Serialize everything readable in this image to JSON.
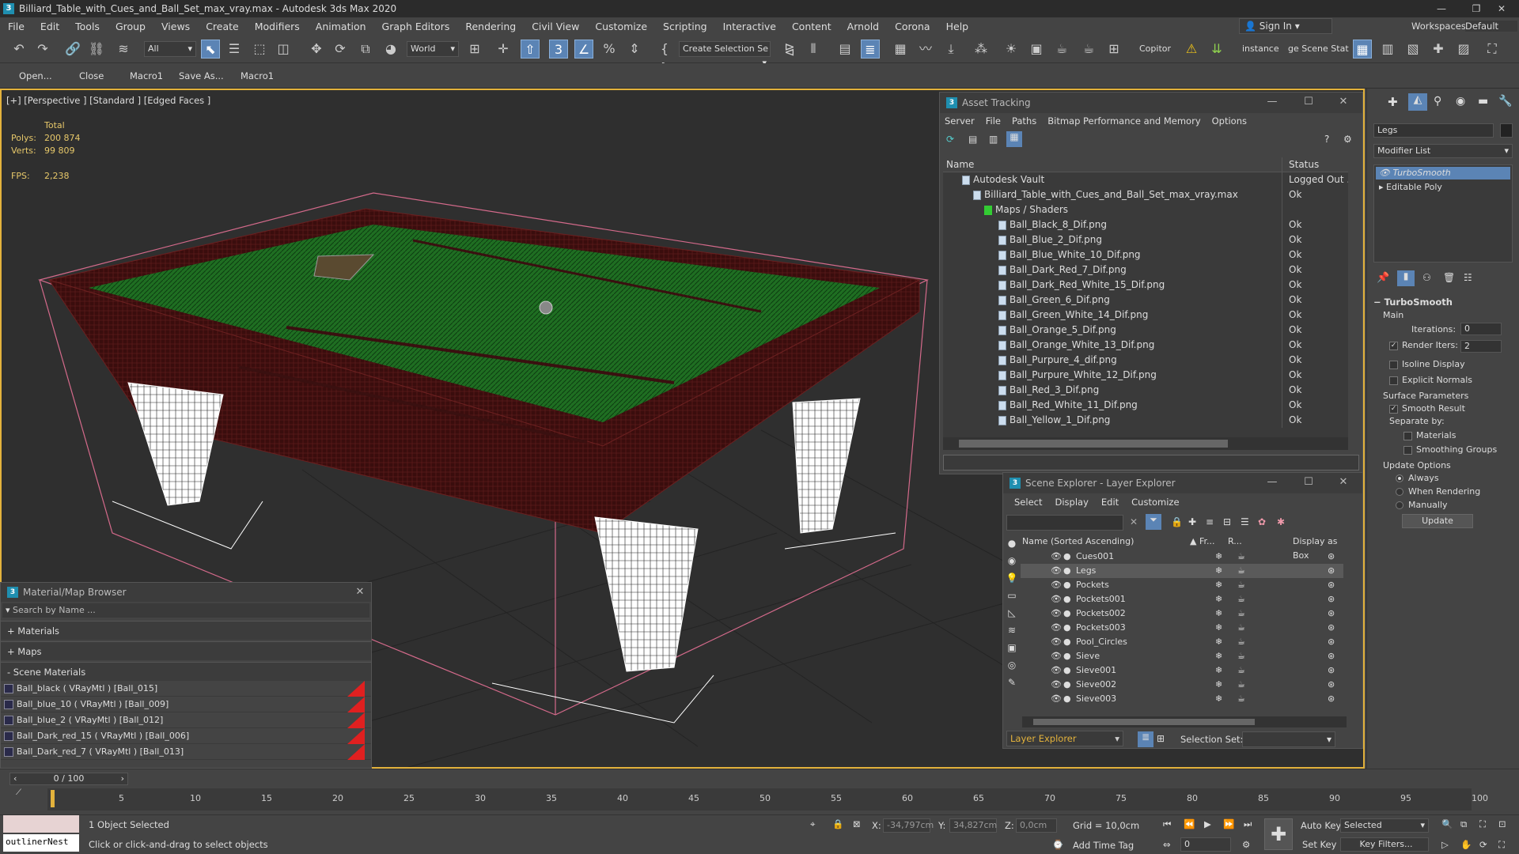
{
  "window": {
    "title": "Billiard_Table_with_Cues_and_Ball_Set_max_vray.max - Autodesk 3ds Max 2020",
    "sign_in": "Sign In",
    "workspaces_label": "Workspaces:",
    "workspaces_value": "Default"
  },
  "menu": [
    "File",
    "Edit",
    "Tools",
    "Group",
    "Views",
    "Create",
    "Modifiers",
    "Animation",
    "Graph Editors",
    "Rendering",
    "Civil View",
    "Customize",
    "Scripting",
    "Interactive",
    "Content",
    "Arnold",
    "Corona",
    "Help"
  ],
  "toolbar": {
    "filter": "All",
    "coord": "World",
    "selection_set": "Create Selection Se",
    "copitor": "Copitor",
    "instance": "instance",
    "scene_stat": "ge Scene Stat"
  },
  "macros": [
    "Open...",
    "Close",
    "Macro1",
    "Save As...",
    "Macro1"
  ],
  "viewport": {
    "label": "[+] [Perspective ] [Standard ] [Edged Faces ]",
    "total_label": "Total",
    "polys_label": "Polys:",
    "polys": "200 874",
    "verts_label": "Verts:",
    "verts": "99 809",
    "fps_label": "FPS:",
    "fps": "2,238"
  },
  "asset_tracking": {
    "title": "Asset Tracking",
    "menu": [
      "Server",
      "File",
      "Paths",
      "Bitmap Performance and Memory",
      "Options"
    ],
    "col_name": "Name",
    "col_status": "Status",
    "rows": [
      {
        "name": "Autodesk Vault",
        "status": "Logged Out ..."
      },
      {
        "name": "Billiard_Table_with_Cues_and_Ball_Set_max_vray.max",
        "status": "Ok"
      },
      {
        "name": "Maps / Shaders",
        "status": ""
      },
      {
        "name": "Ball_Black_8_Dif.png",
        "status": "Ok"
      },
      {
        "name": "Ball_Blue_2_Dif.png",
        "status": "Ok"
      },
      {
        "name": "Ball_Blue_White_10_Dif.png",
        "status": "Ok"
      },
      {
        "name": "Ball_Dark_Red_7_Dif.png",
        "status": "Ok"
      },
      {
        "name": "Ball_Dark_Red_White_15_Dif.png",
        "status": "Ok"
      },
      {
        "name": "Ball_Green_6_Dif.png",
        "status": "Ok"
      },
      {
        "name": "Ball_Green_White_14_Dif.png",
        "status": "Ok"
      },
      {
        "name": "Ball_Orange_5_Dif.png",
        "status": "Ok"
      },
      {
        "name": "Ball_Orange_White_13_Dif.png",
        "status": "Ok"
      },
      {
        "name": "Ball_Purpure_4_dif.png",
        "status": "Ok"
      },
      {
        "name": "Ball_Purpure_White_12_Dif.png",
        "status": "Ok"
      },
      {
        "name": "Ball_Red_3_Dif.png",
        "status": "Ok"
      },
      {
        "name": "Ball_Red_White_11_Dif.png",
        "status": "Ok"
      },
      {
        "name": "Ball_Yellow_1_Dif.png",
        "status": "Ok"
      }
    ]
  },
  "scene_explorer": {
    "title": "Scene Explorer - Layer Explorer",
    "menu": [
      "Select",
      "Display",
      "Edit",
      "Customize"
    ],
    "col_name": "Name (Sorted Ascending)",
    "col_fr": "Fr...",
    "col_r": "R...",
    "col_box": "Display as Box",
    "items": [
      "Cues001",
      "Legs",
      "Pockets",
      "Pockets001",
      "Pockets002",
      "Pockets003",
      "Pool_Circles",
      "Sieve",
      "Sieve001",
      "Sieve002",
      "Sieve003"
    ],
    "selected_item": "Legs",
    "explorer_dropdown": "Layer Explorer",
    "selection_set_label": "Selection Set:"
  },
  "material_browser": {
    "title": "Material/Map Browser",
    "search_placeholder": "Search by Name ...",
    "groups": [
      "+ Materials",
      "+ Maps",
      "- Scene Materials"
    ],
    "materials": [
      "Ball_black  ( VRayMtl )  [Ball_015]",
      "Ball_blue_10  ( VRayMtl )  [Ball_009]",
      "Ball_blue_2  ( VRayMtl )  [Ball_012]",
      "Ball_Dark_red_15  ( VRayMtl )  [Ball_006]",
      "Ball_Dark_red_7  ( VRayMtl )  [Ball_013]"
    ]
  },
  "command_panel": {
    "object_name": "Legs",
    "modifier_list": "Modifier List",
    "stack": [
      "TurboSmooth",
      "Editable Poly"
    ],
    "rollout_title": "TurboSmooth",
    "main_label": "Main",
    "iterations_label": "Iterations:",
    "iterations": "0",
    "render_iters_label": "Render Iters:",
    "render_iters": "2",
    "isoline": "Isoline Display",
    "explicit_normals": "Explicit Normals",
    "surface_params": "Surface Parameters",
    "smooth_result": "Smooth Result",
    "separate_by": "Separate by:",
    "materials": "Materials",
    "smoothing_groups": "Smoothing Groups",
    "update_options": "Update Options",
    "always": "Always",
    "when_rendering": "When Rendering",
    "manually": "Manually",
    "update_btn": "Update"
  },
  "timeline": {
    "frame": "0 / 100",
    "ticks": [
      "5",
      "10",
      "15",
      "20",
      "25",
      "30",
      "35",
      "40",
      "45",
      "50",
      "55",
      "60",
      "65",
      "70",
      "75",
      "80",
      "85",
      "90",
      "95",
      "100"
    ]
  },
  "status": {
    "script_field": "outlinerNest",
    "selected": "1 Object Selected",
    "hint": "Click or click-and-drag to select objects",
    "x_label": "X:",
    "x": "-34,797cm",
    "y_label": "Y:",
    "y": "34,827cm",
    "z_label": "Z:",
    "z": "0,0cm",
    "grid": "Grid = 10,0cm",
    "add_time_tag": "Add Time Tag",
    "auto_key": "Auto Key",
    "selected_dd": "Selected",
    "set_key": "Set Key",
    "key_filters": "Key Filters...",
    "frame_field": "0"
  }
}
